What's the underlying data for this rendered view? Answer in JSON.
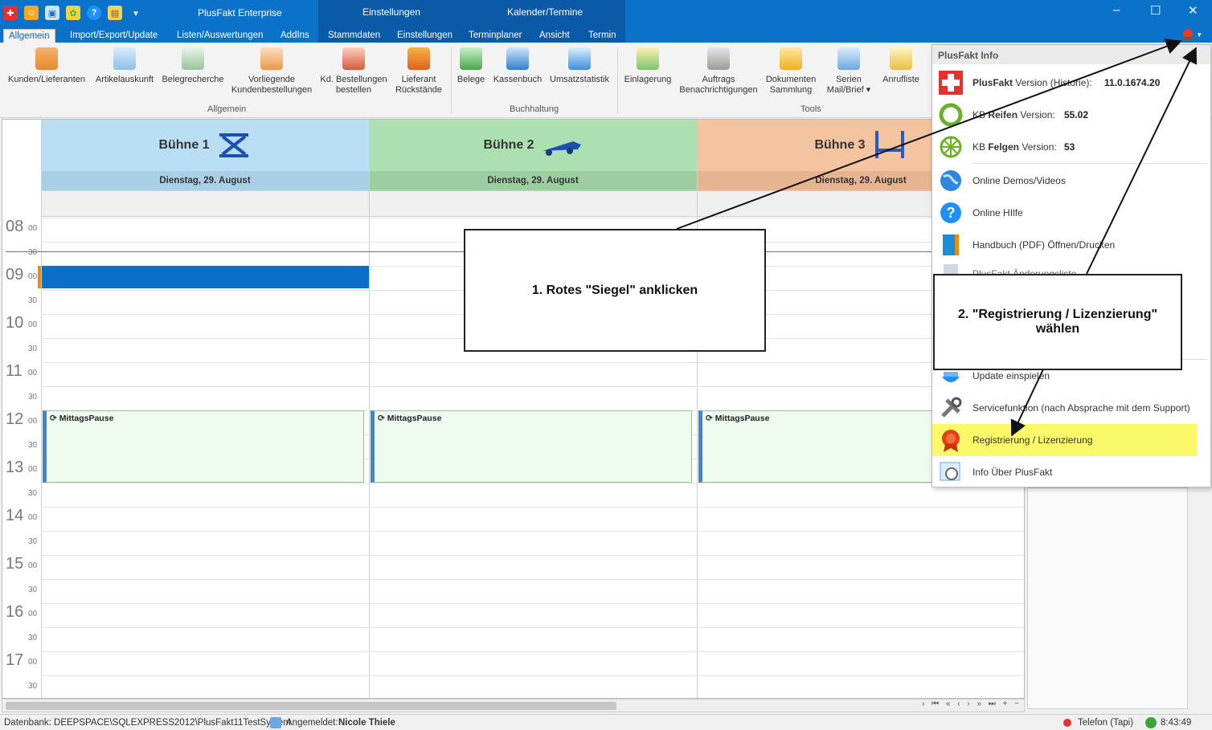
{
  "titlebar": {
    "app_title": "PlusFakt Enterprise",
    "ctx_einstellungen": "Einstellungen",
    "ctx_kalender": "Kalender/Termine",
    "qat_dropdown": "▾"
  },
  "tabs": [
    "Allgemein",
    "Import/Export/Update",
    "Listen/Auswertungen",
    "AddIns",
    "Stammdaten",
    "Einstellungen",
    "Terminplaner",
    "Ansicht",
    "Termin"
  ],
  "ribbon": {
    "groups": {
      "allgemein": "Allgemein",
      "buchhaltung": "Buchhaltung",
      "tools": "Tools"
    },
    "buttons": [
      "Kunden/Lieferanten",
      "Artikelauskunft",
      "Belegrecherche",
      "Vorliegende\nKundenbestellungen",
      "Kd. Bestellungen\nbestellen",
      "Lieferant\nRückstände",
      "Belege",
      "Kassenbuch",
      "Umsatzstatistik",
      "Einlagerung",
      "Auftrags\nBenachrichtigungen",
      "Dokumenten\nSammlung",
      "Serien\nMail/Brief ▾",
      "Anrufliste"
    ]
  },
  "calendar": {
    "resources": [
      {
        "name": "Bühne 1",
        "date": "Dienstag, 29. August",
        "color": "#b9def4",
        "datecolor": "#a8cfe6"
      },
      {
        "name": "Bühne 2",
        "date": "Dienstag, 29. August",
        "color": "#ace0b2",
        "datecolor": "#9ccea2"
      },
      {
        "name": "Bühne 3",
        "date": "Dienstag, 29. August",
        "color": "#f4c3a0",
        "datecolor": "#e6b490"
      }
    ],
    "hours": [
      "08",
      "09",
      "10",
      "11",
      "12",
      "13",
      "14",
      "15",
      "16",
      "17"
    ],
    "min_00": "00",
    "min_30": "30",
    "appointment": "MittagsPause"
  },
  "menu": {
    "header": "PlusFakt Info",
    "plusfakt_bold": "PlusFakt",
    "plusfakt_rest": " Version (Historie):",
    "plusfakt_version": "11.0.1674.20",
    "kb_reifen_pre": "KB ",
    "kb_reifen_bold": "Reifen",
    "kb_reifen_rest": " Version:",
    "kb_reifen_version": "55.02",
    "kb_felgen_pre": "KB ",
    "kb_felgen_bold": "Felgen",
    "kb_felgen_rest": " Version:",
    "kb_felgen_version": "53",
    "online_demos": "Online Demos/Videos",
    "online_hilfe": "Online HIlfe",
    "handbuch": "Handbuch (PDF) Öffnen/Drucken",
    "partial_item": "PlusFakt Änderungsliste",
    "update": "Update einspielen",
    "service": "Servicefunktion (nach Absprache mit dem Support)",
    "registrierung": "Registrierung / Lizenzierung",
    "info": "Info Über PlusFakt"
  },
  "callouts": {
    "one": "1. Rotes \"Siegel\" anklicken",
    "two": "2. \"Registrierung / Lizenzierung\" wählen"
  },
  "statusbar": {
    "db": "Datenbank: DEEPSPACE\\SQLEXPRESS2012\\PlusFakt11TestSystem",
    "user_label": "Angemeldet:",
    "user_name": "Nicole Thiele",
    "phone": "Telefon (Tapi)",
    "time": "8:43:49"
  },
  "colors": {
    "accent": "#0a72c9",
    "highlight": "#fbf96a",
    "appt_border": "#4a7fd6"
  }
}
